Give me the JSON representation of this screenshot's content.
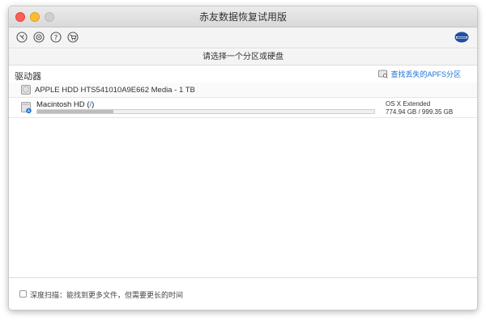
{
  "window": {
    "title": "赤友数据恢复试用版"
  },
  "toolbar": {
    "icons": [
      "history-icon",
      "settings-icon",
      "help-icon",
      "cart-icon"
    ],
    "brand_icon": "brand-logo-icon"
  },
  "prompt": "请选择一个分区或硬盘",
  "section": {
    "title": "驱动器",
    "apfs_link": "查找丢失的APFS分区",
    "apfs_icon": "disk-search-icon"
  },
  "disk": {
    "label": "APPLE HDD HTS541010A9E662 Media - 1 TB",
    "icon": "hard-disk-icon"
  },
  "volume": {
    "name": "Macintosh HD",
    "mount_open": "(",
    "mount_path": "/",
    "mount_close": ")",
    "filesystem": "OS X Extended",
    "size_text": "774.94 GB / 999.35 GB",
    "usage_fraction": 0.2249,
    "icon": "volume-drive-icon"
  },
  "footer": {
    "deep_scan_label": "深度扫描：能找到更多文件，但需要更长的时间",
    "deep_scan_checked": false
  },
  "colors": {
    "link": "#1a6fd1",
    "close": "#fc5f57",
    "minimize": "#fdbc2e",
    "maximize": "#cfcfcf"
  }
}
